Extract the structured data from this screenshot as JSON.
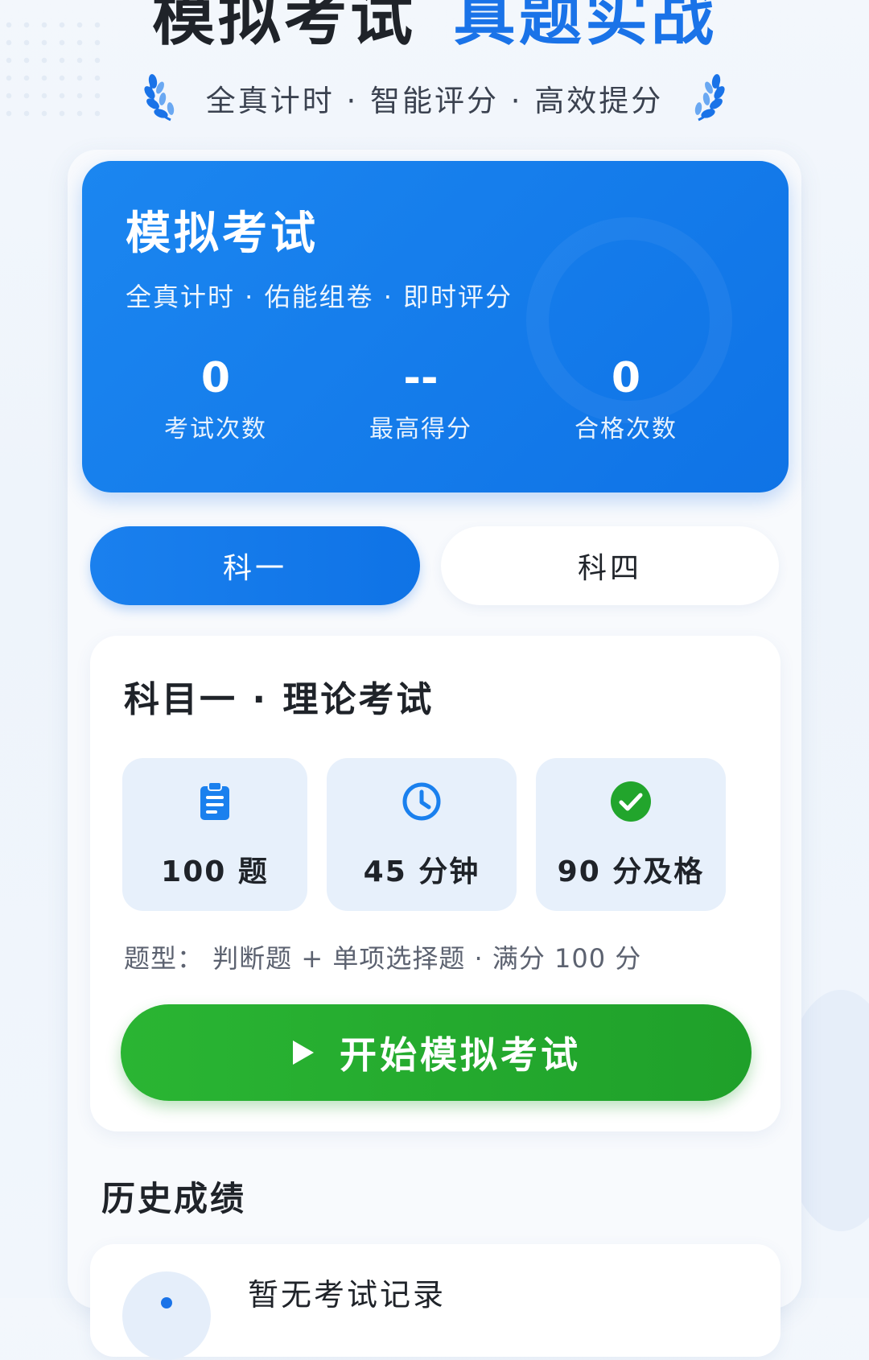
{
  "hero": {
    "title_dark": "模拟考试",
    "title_blue": "真题实战",
    "subtitle": "全真计时 · 智能评分 · 高效提分"
  },
  "summary_card": {
    "title": "模拟考试",
    "subtitle": "全真计时 · 佑能组卷 · 即时评分",
    "stats": [
      {
        "value": "0",
        "label": "考试次数"
      },
      {
        "value": "--",
        "label": "最高得分"
      },
      {
        "value": "0",
        "label": "合格次数"
      }
    ]
  },
  "tabs": [
    {
      "label": "科一",
      "active": true
    },
    {
      "label": "科四",
      "active": false
    }
  ],
  "exam_card": {
    "title": "科目一 · 理论考试",
    "info": [
      {
        "icon": "clipboard-icon",
        "text": "100 题"
      },
      {
        "icon": "clock-icon",
        "text": "45 分钟"
      },
      {
        "icon": "check-circle-icon",
        "text": "90 分及格"
      }
    ],
    "description": "题型： 判断题 + 单项选择题 · 满分 100 分",
    "start_button": {
      "label": "开始模拟考试",
      "icon": "play-icon"
    }
  },
  "history": {
    "title": "历史成绩",
    "empty_text": "暂无考试记录"
  },
  "colors": {
    "primary": "#1a73e8",
    "success": "#22a52c",
    "text": "#1f2329"
  }
}
